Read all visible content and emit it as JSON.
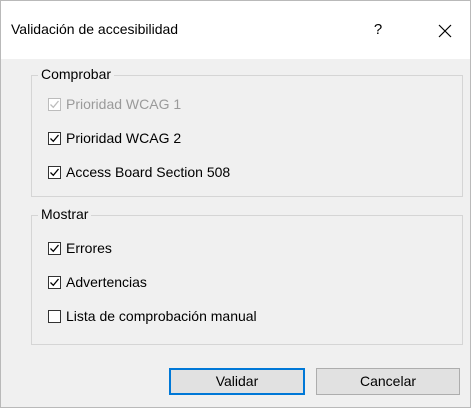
{
  "window": {
    "title": "Validación de accesibilidad",
    "help_label": "?"
  },
  "check_group": {
    "legend": "Comprobar",
    "items": [
      {
        "label": "Prioridad WCAG 1",
        "checked": true,
        "disabled": true
      },
      {
        "label": "Prioridad WCAG 2",
        "checked": true,
        "disabled": false
      },
      {
        "label": "Access Board Section 508",
        "checked": true,
        "disabled": false
      }
    ]
  },
  "show_group": {
    "legend": "Mostrar",
    "items": [
      {
        "label": "Errores",
        "checked": true
      },
      {
        "label": "Advertencias",
        "checked": true
      },
      {
        "label": "Lista de comprobación manual",
        "checked": false
      }
    ]
  },
  "buttons": {
    "validate": "Validar",
    "cancel": "Cancelar"
  },
  "colors": {
    "primary_border": "#0078d7",
    "dialog_bg": "#f0f0f0",
    "titlebar_bg": "#ffffff"
  }
}
